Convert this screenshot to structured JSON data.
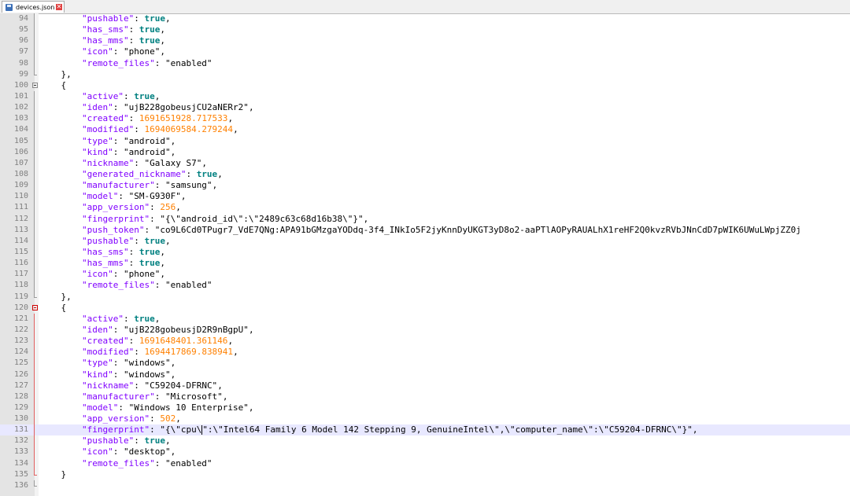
{
  "tab": {
    "filename": "devices.json",
    "close_symbol": "✕",
    "icon": "save-disk-icon"
  },
  "colors": {
    "key": "#8000ff",
    "string": "#000000",
    "bool": "#008080",
    "number": "#ff8000",
    "current_line": "#e8e8ff"
  },
  "editor": {
    "current_line": 131,
    "lines": [
      {
        "no": "94",
        "fold": "v",
        "active": false,
        "tokens": [
          [
            "p",
            "        "
          ],
          [
            "k",
            "\"pushable\""
          ],
          [
            "p",
            ": "
          ],
          [
            "b",
            "true"
          ],
          [
            "p",
            ","
          ]
        ]
      },
      {
        "no": "95",
        "fold": "v",
        "active": false,
        "tokens": [
          [
            "p",
            "        "
          ],
          [
            "k",
            "\"has_sms\""
          ],
          [
            "p",
            ": "
          ],
          [
            "b",
            "true"
          ],
          [
            "p",
            ","
          ]
        ]
      },
      {
        "no": "96",
        "fold": "v",
        "active": false,
        "tokens": [
          [
            "p",
            "        "
          ],
          [
            "k",
            "\"has_mms\""
          ],
          [
            "p",
            ": "
          ],
          [
            "b",
            "true"
          ],
          [
            "p",
            ","
          ]
        ]
      },
      {
        "no": "97",
        "fold": "v",
        "active": false,
        "tokens": [
          [
            "p",
            "        "
          ],
          [
            "k",
            "\"icon\""
          ],
          [
            "p",
            ": "
          ],
          [
            "s",
            "\"phone\""
          ],
          [
            "p",
            ","
          ]
        ]
      },
      {
        "no": "98",
        "fold": "v",
        "active": false,
        "tokens": [
          [
            "p",
            "        "
          ],
          [
            "k",
            "\"remote_files\""
          ],
          [
            "p",
            ": "
          ],
          [
            "s",
            "\"enabled\""
          ]
        ]
      },
      {
        "no": "99",
        "fold": "end",
        "active": false,
        "tokens": [
          [
            "p",
            "    },"
          ]
        ]
      },
      {
        "no": "100",
        "fold": "box",
        "active": false,
        "tokens": [
          [
            "p",
            "    {"
          ]
        ]
      },
      {
        "no": "101",
        "fold": "v",
        "active": false,
        "tokens": [
          [
            "p",
            "        "
          ],
          [
            "k",
            "\"active\""
          ],
          [
            "p",
            ": "
          ],
          [
            "b",
            "true"
          ],
          [
            "p",
            ","
          ]
        ]
      },
      {
        "no": "102",
        "fold": "v",
        "active": false,
        "tokens": [
          [
            "p",
            "        "
          ],
          [
            "k",
            "\"iden\""
          ],
          [
            "p",
            ": "
          ],
          [
            "s",
            "\"ujB228gobeusjCU2aNERr2\""
          ],
          [
            "p",
            ","
          ]
        ]
      },
      {
        "no": "103",
        "fold": "v",
        "active": false,
        "tokens": [
          [
            "p",
            "        "
          ],
          [
            "k",
            "\"created\""
          ],
          [
            "p",
            ": "
          ],
          [
            "n",
            "1691651928.717533"
          ],
          [
            "p",
            ","
          ]
        ]
      },
      {
        "no": "104",
        "fold": "v",
        "active": false,
        "tokens": [
          [
            "p",
            "        "
          ],
          [
            "k",
            "\"modified\""
          ],
          [
            "p",
            ": "
          ],
          [
            "n",
            "1694069584.279244"
          ],
          [
            "p",
            ","
          ]
        ]
      },
      {
        "no": "105",
        "fold": "v",
        "active": false,
        "tokens": [
          [
            "p",
            "        "
          ],
          [
            "k",
            "\"type\""
          ],
          [
            "p",
            ": "
          ],
          [
            "s",
            "\"android\""
          ],
          [
            "p",
            ","
          ]
        ]
      },
      {
        "no": "106",
        "fold": "v",
        "active": false,
        "tokens": [
          [
            "p",
            "        "
          ],
          [
            "k",
            "\"kind\""
          ],
          [
            "p",
            ": "
          ],
          [
            "s",
            "\"android\""
          ],
          [
            "p",
            ","
          ]
        ]
      },
      {
        "no": "107",
        "fold": "v",
        "active": false,
        "tokens": [
          [
            "p",
            "        "
          ],
          [
            "k",
            "\"nickname\""
          ],
          [
            "p",
            ": "
          ],
          [
            "s",
            "\"Galaxy S7\""
          ],
          [
            "p",
            ","
          ]
        ]
      },
      {
        "no": "108",
        "fold": "v",
        "active": false,
        "tokens": [
          [
            "p",
            "        "
          ],
          [
            "k",
            "\"generated_nickname\""
          ],
          [
            "p",
            ": "
          ],
          [
            "b",
            "true"
          ],
          [
            "p",
            ","
          ]
        ]
      },
      {
        "no": "109",
        "fold": "v",
        "active": false,
        "tokens": [
          [
            "p",
            "        "
          ],
          [
            "k",
            "\"manufacturer\""
          ],
          [
            "p",
            ": "
          ],
          [
            "s",
            "\"samsung\""
          ],
          [
            "p",
            ","
          ]
        ]
      },
      {
        "no": "110",
        "fold": "v",
        "active": false,
        "tokens": [
          [
            "p",
            "        "
          ],
          [
            "k",
            "\"model\""
          ],
          [
            "p",
            ": "
          ],
          [
            "s",
            "\"SM-G930F\""
          ],
          [
            "p",
            ","
          ]
        ]
      },
      {
        "no": "111",
        "fold": "v",
        "active": false,
        "tokens": [
          [
            "p",
            "        "
          ],
          [
            "k",
            "\"app_version\""
          ],
          [
            "p",
            ": "
          ],
          [
            "n",
            "256"
          ],
          [
            "p",
            ","
          ]
        ]
      },
      {
        "no": "112",
        "fold": "v",
        "active": false,
        "tokens": [
          [
            "p",
            "        "
          ],
          [
            "k",
            "\"fingerprint\""
          ],
          [
            "p",
            ": "
          ],
          [
            "s",
            "\"{\\\"android_id\\\":\\\"2489c63c68d16b38\\\"}\""
          ],
          [
            "p",
            ","
          ]
        ]
      },
      {
        "no": "113",
        "fold": "v",
        "active": false,
        "tokens": [
          [
            "p",
            "        "
          ],
          [
            "k",
            "\"push_token\""
          ],
          [
            "p",
            ": "
          ],
          [
            "s",
            "\"co9L6Cd0TPugr7_VdE7QNg:APA91bGMzgaYODdq-3f4_INkIo5F2jyKnnDyUKGT3yD8o2-aaPTlAOPyRAUALhX1reHF2Q0kvzRVbJNnCdD7pWIK6UWuLWpjZZ0j"
          ]
        ]
      },
      {
        "no": "114",
        "fold": "v",
        "active": false,
        "tokens": [
          [
            "p",
            "        "
          ],
          [
            "k",
            "\"pushable\""
          ],
          [
            "p",
            ": "
          ],
          [
            "b",
            "true"
          ],
          [
            "p",
            ","
          ]
        ]
      },
      {
        "no": "115",
        "fold": "v",
        "active": false,
        "tokens": [
          [
            "p",
            "        "
          ],
          [
            "k",
            "\"has_sms\""
          ],
          [
            "p",
            ": "
          ],
          [
            "b",
            "true"
          ],
          [
            "p",
            ","
          ]
        ]
      },
      {
        "no": "116",
        "fold": "v",
        "active": false,
        "tokens": [
          [
            "p",
            "        "
          ],
          [
            "k",
            "\"has_mms\""
          ],
          [
            "p",
            ": "
          ],
          [
            "b",
            "true"
          ],
          [
            "p",
            ","
          ]
        ]
      },
      {
        "no": "117",
        "fold": "v",
        "active": false,
        "tokens": [
          [
            "p",
            "        "
          ],
          [
            "k",
            "\"icon\""
          ],
          [
            "p",
            ": "
          ],
          [
            "s",
            "\"phone\""
          ],
          [
            "p",
            ","
          ]
        ]
      },
      {
        "no": "118",
        "fold": "v",
        "active": false,
        "tokens": [
          [
            "p",
            "        "
          ],
          [
            "k",
            "\"remote_files\""
          ],
          [
            "p",
            ": "
          ],
          [
            "s",
            "\"enabled\""
          ]
        ]
      },
      {
        "no": "119",
        "fold": "end",
        "active": false,
        "tokens": [
          [
            "p",
            "    },"
          ]
        ]
      },
      {
        "no": "120",
        "fold": "box",
        "active": true,
        "tokens": [
          [
            "p",
            "    {"
          ]
        ]
      },
      {
        "no": "121",
        "fold": "v",
        "active": true,
        "tokens": [
          [
            "p",
            "        "
          ],
          [
            "k",
            "\"active\""
          ],
          [
            "p",
            ": "
          ],
          [
            "b",
            "true"
          ],
          [
            "p",
            ","
          ]
        ]
      },
      {
        "no": "122",
        "fold": "v",
        "active": true,
        "tokens": [
          [
            "p",
            "        "
          ],
          [
            "k",
            "\"iden\""
          ],
          [
            "p",
            ": "
          ],
          [
            "s",
            "\"ujB228gobeusjD2R9nBgpU\""
          ],
          [
            "p",
            ","
          ]
        ]
      },
      {
        "no": "123",
        "fold": "v",
        "active": true,
        "tokens": [
          [
            "p",
            "        "
          ],
          [
            "k",
            "\"created\""
          ],
          [
            "p",
            ": "
          ],
          [
            "n",
            "1691648401.361146"
          ],
          [
            "p",
            ","
          ]
        ]
      },
      {
        "no": "124",
        "fold": "v",
        "active": true,
        "tokens": [
          [
            "p",
            "        "
          ],
          [
            "k",
            "\"modified\""
          ],
          [
            "p",
            ": "
          ],
          [
            "n",
            "1694417869.838941"
          ],
          [
            "p",
            ","
          ]
        ]
      },
      {
        "no": "125",
        "fold": "v",
        "active": true,
        "tokens": [
          [
            "p",
            "        "
          ],
          [
            "k",
            "\"type\""
          ],
          [
            "p",
            ": "
          ],
          [
            "s",
            "\"windows\""
          ],
          [
            "p",
            ","
          ]
        ]
      },
      {
        "no": "126",
        "fold": "v",
        "active": true,
        "tokens": [
          [
            "p",
            "        "
          ],
          [
            "k",
            "\"kind\""
          ],
          [
            "p",
            ": "
          ],
          [
            "s",
            "\"windows\""
          ],
          [
            "p",
            ","
          ]
        ]
      },
      {
        "no": "127",
        "fold": "v",
        "active": true,
        "tokens": [
          [
            "p",
            "        "
          ],
          [
            "k",
            "\"nickname\""
          ],
          [
            "p",
            ": "
          ],
          [
            "s",
            "\"C59204-DFRNC\""
          ],
          [
            "p",
            ","
          ]
        ]
      },
      {
        "no": "128",
        "fold": "v",
        "active": true,
        "tokens": [
          [
            "p",
            "        "
          ],
          [
            "k",
            "\"manufacturer\""
          ],
          [
            "p",
            ": "
          ],
          [
            "s",
            "\"Microsoft\""
          ],
          [
            "p",
            ","
          ]
        ]
      },
      {
        "no": "129",
        "fold": "v",
        "active": true,
        "tokens": [
          [
            "p",
            "        "
          ],
          [
            "k",
            "\"model\""
          ],
          [
            "p",
            ": "
          ],
          [
            "s",
            "\"Windows 10 Enterprise\""
          ],
          [
            "p",
            ","
          ]
        ]
      },
      {
        "no": "130",
        "fold": "v",
        "active": true,
        "tokens": [
          [
            "p",
            "        "
          ],
          [
            "k",
            "\"app_version\""
          ],
          [
            "p",
            ": "
          ],
          [
            "n",
            "502"
          ],
          [
            "p",
            ","
          ]
        ]
      },
      {
        "no": "131",
        "fold": "v",
        "active": true,
        "tokens": [
          [
            "p",
            "        "
          ],
          [
            "k",
            "\"fingerprint\""
          ],
          [
            "p",
            ": "
          ],
          [
            "s",
            "\"{\\\"cpu\\"
          ],
          [
            "caret",
            ""
          ],
          [
            "s",
            "\":\\\"Intel64 Family 6 Model 142 Stepping 9, GenuineIntel\\\",\\\"computer_name\\\":\\\"C59204-DFRNC\\\"}\""
          ],
          [
            "p",
            ","
          ]
        ]
      },
      {
        "no": "132",
        "fold": "v",
        "active": true,
        "tokens": [
          [
            "p",
            "        "
          ],
          [
            "k",
            "\"pushable\""
          ],
          [
            "p",
            ": "
          ],
          [
            "b",
            "true"
          ],
          [
            "p",
            ","
          ]
        ]
      },
      {
        "no": "133",
        "fold": "v",
        "active": true,
        "tokens": [
          [
            "p",
            "        "
          ],
          [
            "k",
            "\"icon\""
          ],
          [
            "p",
            ": "
          ],
          [
            "s",
            "\"desktop\""
          ],
          [
            "p",
            ","
          ]
        ]
      },
      {
        "no": "134",
        "fold": "v",
        "active": true,
        "tokens": [
          [
            "p",
            "        "
          ],
          [
            "k",
            "\"remote_files\""
          ],
          [
            "p",
            ": "
          ],
          [
            "s",
            "\"enabled\""
          ]
        ]
      },
      {
        "no": "135",
        "fold": "end",
        "active": true,
        "tokens": [
          [
            "p",
            "    }"
          ]
        ]
      },
      {
        "no": "136",
        "fold": "end",
        "active": false,
        "tokens": [
          [
            "p",
            ""
          ]
        ]
      }
    ]
  }
}
